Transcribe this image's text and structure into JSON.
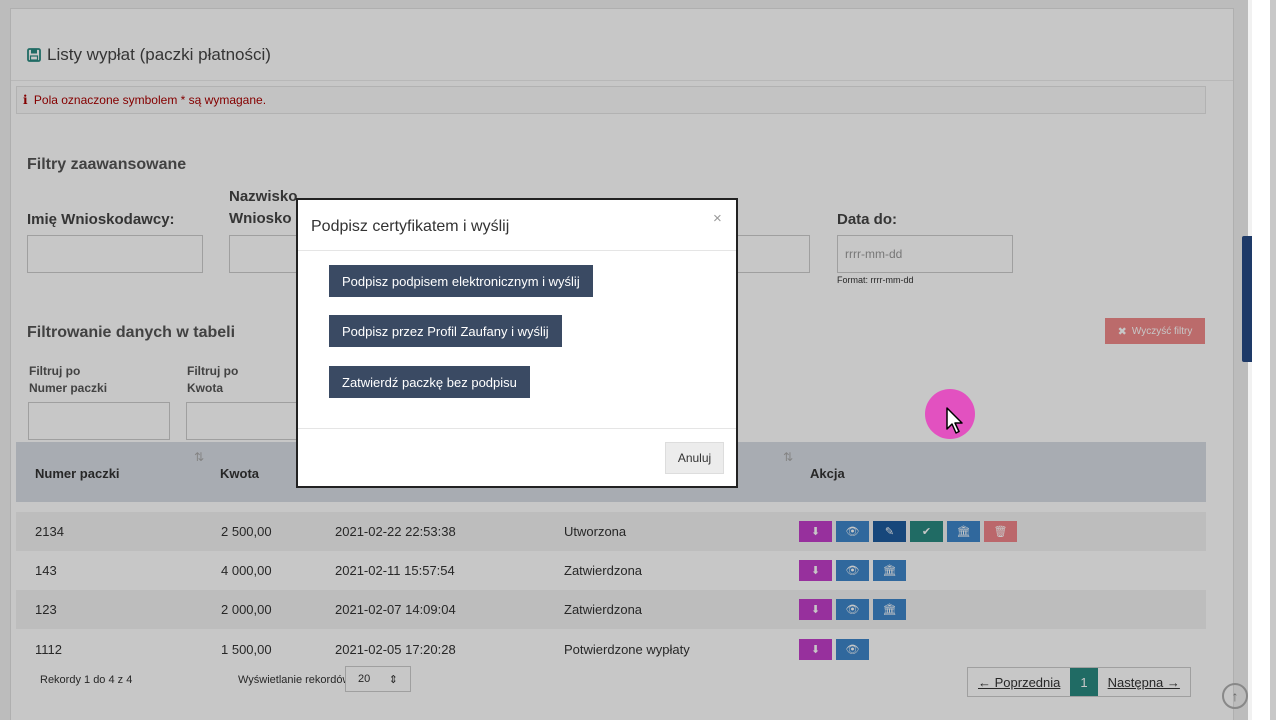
{
  "header": {
    "title": "Listy wypłat (paczki płatności)"
  },
  "alert": {
    "icon": "info-icon",
    "text": "Pola oznaczone symbolem * są wymagane."
  },
  "filters": {
    "title": "Filtry zaawansowane",
    "first_name_label": "Imię Wnioskodawcy:",
    "last_name_label_1": "Nazwisko",
    "last_name_label_2": "Wniosko",
    "date_to_label": "Data do:",
    "date_to_placeholder": "rrrr-mm-dd",
    "date_to_hint": "Format: rrrr-mm-dd"
  },
  "table_filter": {
    "title": "Filtrowanie danych w tabeli",
    "clear_label": "Wyczyść filtry",
    "f1_line1": "Filtruj po",
    "f1_line2": "Numer paczki",
    "f2_line1": "Filtruj po",
    "f2_line2": "Kwota"
  },
  "table": {
    "headers": {
      "numer": "Numer paczki",
      "kwota": "Kwota",
      "akcja": "Akcja"
    },
    "rows": [
      {
        "numer": "2134",
        "kwota": "2 500,00",
        "data": "2021-02-22 22:53:38",
        "status": "Utworzona"
      },
      {
        "numer": "143",
        "kwota": "4 000,00",
        "data": "2021-02-11 15:57:54",
        "status": "Zatwierdzona"
      },
      {
        "numer": "123",
        "kwota": "2 000,00",
        "data": "2021-02-07 14:09:04",
        "status": "Zatwierdzona"
      },
      {
        "numer": "1112",
        "kwota": "1 500,00",
        "data": "2021-02-05 17:20:28",
        "status": "Potwierdzone wypłaty"
      }
    ]
  },
  "footer": {
    "records": "Rekordy 1 do 4 z 4",
    "display_label": "Wyświetlanie rekordów",
    "page_size": "20",
    "prev": "← Poprzednia",
    "page": "1",
    "next": "Następna →"
  },
  "modal": {
    "title": "Podpisz certyfikatem i wyślij",
    "close": "×",
    "btn_electronic": "Podpisz podpisem elektronicznym i wyślij",
    "btn_profile": "Podpisz przez Profil Zaufany i wyślij",
    "btn_approve": "Zatwierdź paczkę bez podpisu",
    "cancel": "Anuluj"
  },
  "colors": {
    "accent": "#2a8a80",
    "modal_button": "#3a4a63",
    "danger": "#f08a8a",
    "magenta": "#c23ec9"
  }
}
